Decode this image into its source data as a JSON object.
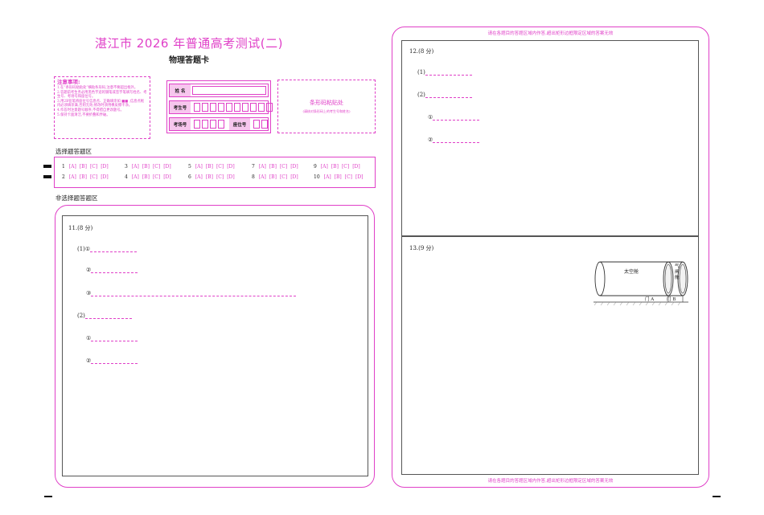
{
  "header": {
    "title": "湛江市 2026 年普通高考测试(二)",
    "subtitle": "物理答题卡"
  },
  "notice": {
    "title": "注意事项:",
    "lines": [
      "1.在“条形码粘贴处”横贴条形码,注意不要超出框外。",
      "2.答题前考生务必用黑色字迹的钢笔或签字笔填写姓名、考生号、考场号和座位号。",
      "3.用2B铅笔将座位号信息点、正确填涂如 ■■ ,信息点框内必须填涂满,否则无效;修改时须用橡皮擦干净。",
      "4.作答时注意题号顺序,不得擅自更改题号。",
      "5.保持卡面清洁,不要折叠和弄破。"
    ]
  },
  "info": {
    "name_label": "姓 名",
    "exam_no_label": "考生号",
    "room_label": "考场号",
    "seat_label": "座位号"
  },
  "barcode": {
    "title": "条形码粘贴处",
    "note": "(请核对条形码上的考生号和姓名)"
  },
  "choice": {
    "section_label": "选择题答题区",
    "options": [
      "[A]",
      "[B]",
      "[C]",
      "[D]"
    ],
    "questions": [
      "1",
      "2",
      "3",
      "4",
      "5",
      "6",
      "7",
      "8",
      "9",
      "10"
    ]
  },
  "nonchoice": {
    "section_label": "非选择题答题区"
  },
  "q11": {
    "title": "11.(8 分)",
    "part1": "(1)①",
    "c2": "②",
    "c3": "③",
    "part2": "(2)",
    "c4": "①",
    "c5": "②"
  },
  "q12": {
    "title": "12.(8 分)",
    "part1": "(1)",
    "part2": "(2)",
    "c1": "①",
    "c2": "②"
  },
  "q13": {
    "title": "13.(9 分)",
    "fig_chamber": "太空舱",
    "fig_airlock": "气闸舱",
    "fig_gate_a": "门 A",
    "fig_gate_b": "门 B"
  },
  "banner": {
    "text": "请在各题目的答题区域内作答,超出矩形边框限定区域的答案无效"
  }
}
